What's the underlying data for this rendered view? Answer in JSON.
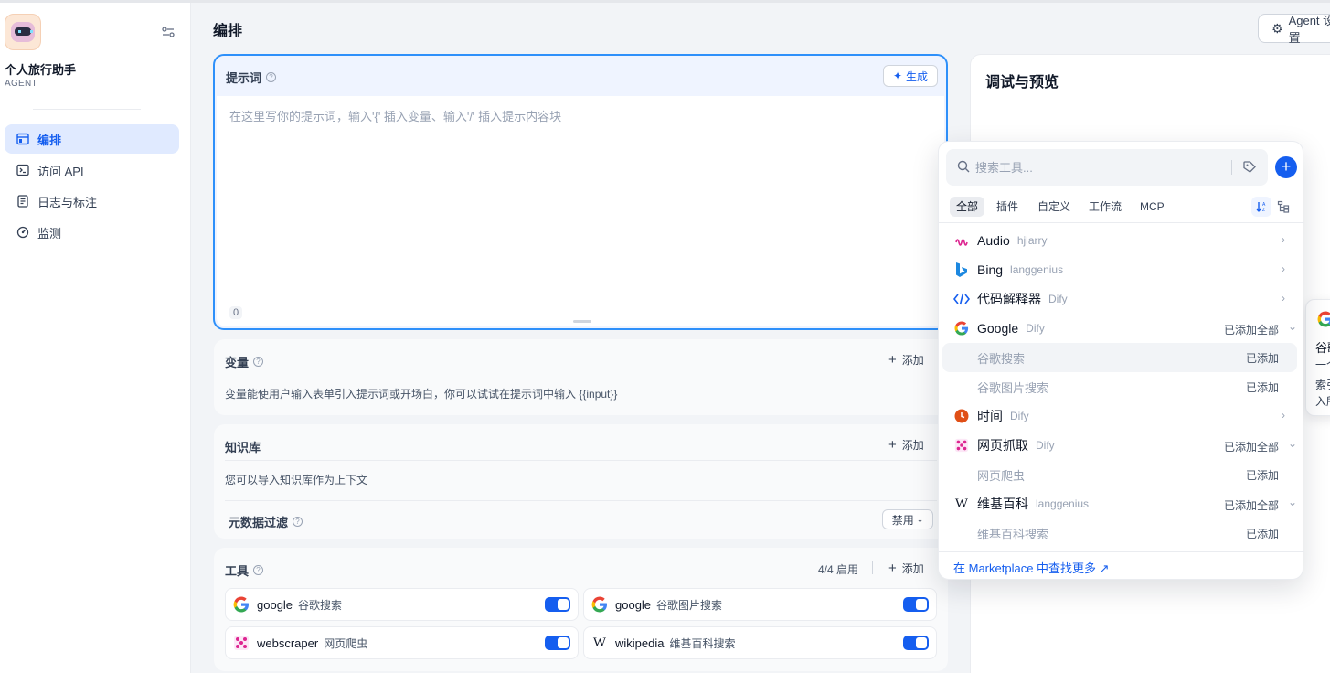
{
  "app": {
    "name": "个人旅行助手",
    "type": "AGENT"
  },
  "sidebar": {
    "items": [
      {
        "label": "编排",
        "icon": "layout-icon",
        "active": true
      },
      {
        "label": "访问 API",
        "icon": "terminal-icon",
        "active": false
      },
      {
        "label": "日志与标注",
        "icon": "document-icon",
        "active": false
      },
      {
        "label": "监测",
        "icon": "gauge-icon",
        "active": false
      }
    ]
  },
  "header": {
    "title": "编排",
    "agent_button": "Agent 设置"
  },
  "prompt": {
    "title": "提示词",
    "generate_label": "生成",
    "placeholder": "在这里写你的提示词，输入'{' 插入变量、输入'/' 插入提示内容块",
    "char_count": "0"
  },
  "variables": {
    "title": "变量",
    "add_label": "添加",
    "description": "变量能使用户输入表单引入提示词或开场白，你可以试试在提示词中输入 {{input}}"
  },
  "knowledge": {
    "title": "知识库",
    "add_label": "添加",
    "description": "您可以导入知识库作为上下文",
    "metadata_filter_label": "元数据过滤",
    "metadata_filter_value": "禁用"
  },
  "tools": {
    "title": "工具",
    "enabled_count": "4/4 启用",
    "add_label": "添加",
    "items": [
      {
        "provider": "google",
        "name": "谷歌搜索",
        "enabled": true
      },
      {
        "provider": "google",
        "name": "谷歌图片搜索",
        "enabled": true
      },
      {
        "provider": "webscraper",
        "name": "网页爬虫",
        "enabled": true
      },
      {
        "provider": "wikipedia",
        "name": "维基百科搜索",
        "enabled": true
      }
    ]
  },
  "debug": {
    "title": "调试与预览"
  },
  "picker": {
    "search_placeholder": "搜索工具...",
    "tabs": [
      "全部",
      "插件",
      "自定义",
      "工作流",
      "MCP"
    ],
    "active_tab": "全部",
    "providers": [
      {
        "name": "Audio",
        "author": "hjlarry",
        "icon": "audio-icon"
      },
      {
        "name": "Bing",
        "author": "langgenius",
        "icon": "bing-icon"
      },
      {
        "name": "代码解释器",
        "author": "Dify",
        "icon": "code-icon"
      },
      {
        "name": "Google",
        "author": "Dify",
        "icon": "google-icon",
        "status": "已添加全部",
        "subtools": [
          {
            "name": "谷歌搜索",
            "status": "已添加"
          },
          {
            "name": "谷歌图片搜索",
            "status": "已添加"
          }
        ]
      },
      {
        "name": "时间",
        "author": "Dify",
        "icon": "clock-icon"
      },
      {
        "name": "网页抓取",
        "author": "Dify",
        "icon": "webscraper-icon",
        "status": "已添加全部",
        "subtools": [
          {
            "name": "网页爬虫",
            "status": "已添加"
          }
        ]
      },
      {
        "name": "维基百科",
        "author": "langgenius",
        "icon": "wikipedia-icon",
        "status": "已添加全部",
        "subtools": [
          {
            "name": "维基百科搜索",
            "status": "已添加"
          }
        ]
      }
    ],
    "marketplace_link": "在 Marketplace 中查找更多 ↗"
  },
  "side_card": {
    "line1": "谷歌",
    "line2": "一个",
    "line3": "索引",
    "line4": "入所"
  },
  "colors": {
    "accent": "#155eef",
    "prompt_border": "#2e90fa",
    "prompt_bg": "#eff4ff"
  }
}
